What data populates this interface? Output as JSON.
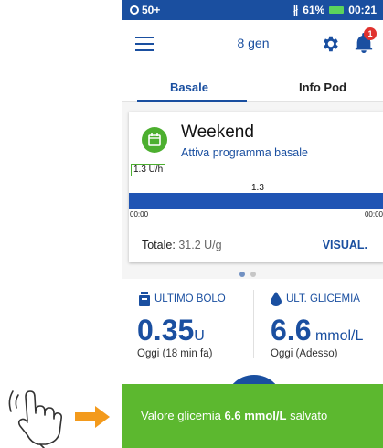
{
  "status_bar": {
    "notif_count": "50+",
    "battery_pct": "61%",
    "time": "00:21"
  },
  "app_bar": {
    "date": "8 gen",
    "notification_badge": "1"
  },
  "tabs": [
    {
      "label": "Basale",
      "active": true
    },
    {
      "label": "Info Pod",
      "active": false
    }
  ],
  "basal_card": {
    "program_name": "Weekend",
    "activate_link": "Attiva programma basale",
    "rate_tag": "1.3 U/h",
    "bar_value": "1.3",
    "time_start": "00:00",
    "time_end": "00:00",
    "total_label": "Totale:",
    "total_value": "31.2 U/g",
    "view_button": "VISUAL."
  },
  "pager": {
    "pages": 2,
    "current": 1
  },
  "last_bolus": {
    "label": "ULTIMO BOLO",
    "value": "0.35",
    "unit": "U",
    "time": "Oggi (18 min fa)"
  },
  "last_glucose": {
    "label": "ULT. GLICEMIA",
    "value": "6.6",
    "unit": "mmol/L",
    "time": "Oggi (Adesso)"
  },
  "toast": {
    "prefix": "Valore glicemia ",
    "value": "6.6 mmol/L",
    "suffix": " salvato"
  },
  "colors": {
    "brand_blue": "#1a4fa0",
    "success_green": "#5cb82f",
    "alert_red": "#e0322e",
    "gesture_arrow": "#f39a1c"
  }
}
